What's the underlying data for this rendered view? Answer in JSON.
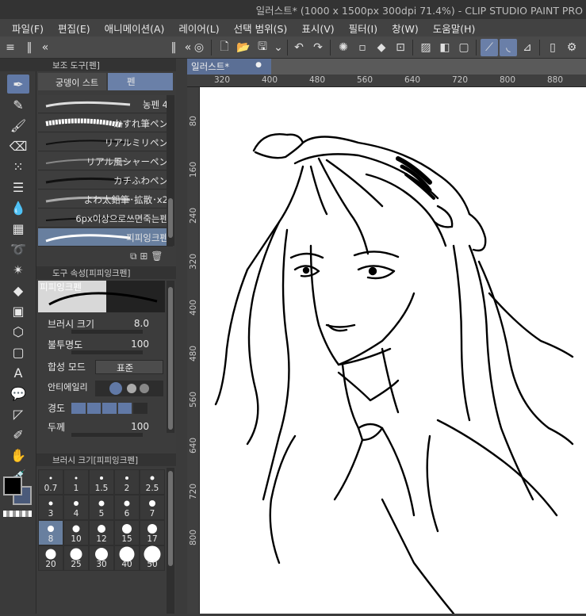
{
  "app": {
    "title": "일러스트* (1000 x 1500px 300dpi 71.4%)  - CLIP STUDIO PAINT PRO"
  },
  "menu": [
    "파일(F)",
    "편집(E)",
    "애니메이션(A)",
    "레이어(L)",
    "선택 범위(S)",
    "표시(V)",
    "필터(I)",
    "창(W)",
    "도움말(H)"
  ],
  "subtool_panel": {
    "header": "보조 도구[펜]",
    "tabs": [
      "궁뎅이 스트",
      "펜"
    ],
    "brushes": [
      "농펜 4",
      "かすれ筆ペン",
      "リアルミリペン",
      "リアル風シャーペン",
      "カチふわペン",
      "よわ太鉛筆･拡散･x2",
      "6px이상으로쓰면죽는펜",
      "피피잉크펜"
    ],
    "selected_brush": "피피잉크펜"
  },
  "tool_property": {
    "header": "도구 속성[피피잉크펜]",
    "preview_label": "피피잉크펜",
    "rows": [
      {
        "label": "브러시 크기",
        "value": "8.0"
      },
      {
        "label": "불투명도",
        "value": "100"
      },
      {
        "label": "합성 모드",
        "value": "표준"
      },
      {
        "label": "안티에일리",
        "value": ""
      },
      {
        "label": "경도",
        "value": ""
      },
      {
        "label": "두께",
        "value": "100"
      }
    ]
  },
  "brush_size_panel": {
    "header": "브러시 크기[피피잉크펜]",
    "sizes": [
      "0.7",
      "1",
      "1.5",
      "2",
      "2.5",
      "3",
      "4",
      "5",
      "6",
      "7",
      "8",
      "10",
      "12",
      "15",
      "17",
      "20",
      "25",
      "30",
      "40",
      "50"
    ],
    "selected": "8"
  },
  "canvas": {
    "tab_label": "일러스트*",
    "ruler_h": [
      "320",
      "400",
      "480",
      "560",
      "640",
      "720",
      "800",
      "880"
    ],
    "ruler_v": [
      "80",
      "160",
      "240",
      "320",
      "400",
      "480",
      "560",
      "640",
      "720",
      "800"
    ]
  },
  "colors": {
    "main": "#000000",
    "sub": "#4a5a7a",
    "accent": "#6179a6"
  }
}
